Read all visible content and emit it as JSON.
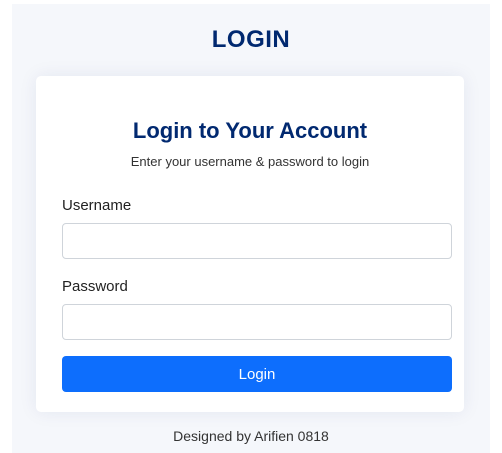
{
  "header": {
    "title": "LOGIN"
  },
  "card": {
    "title": "Login to Your Account",
    "subtitle": "Enter your username & password to login",
    "username": {
      "label": "Username",
      "value": "",
      "placeholder": ""
    },
    "password": {
      "label": "Password",
      "value": "",
      "placeholder": ""
    },
    "submit_label": "Login"
  },
  "footer": {
    "credits": "Designed by Arifien 0818"
  },
  "colors": {
    "primary": "#0d6efd",
    "heading": "#012970",
    "background": "#f5f7fb"
  }
}
